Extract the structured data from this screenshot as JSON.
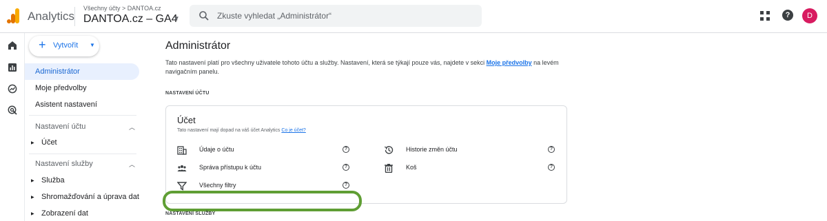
{
  "header": {
    "app_name": "Analytics",
    "breadcrumb": "Všechny účty > DANTOA.cz",
    "property": "DANTOA.cz – GA4",
    "search_placeholder": "Zkuste vyhledat „Administrátor“",
    "avatar_initial": "D",
    "help_glyph": "?",
    "icons": [
      "analytics-logo",
      "search-icon",
      "apps-icon",
      "help-icon"
    ],
    "accent_color": "#1a73e8"
  },
  "rail": {
    "icons": [
      "home-icon",
      "reports-icon",
      "explore-icon",
      "advertising-icon"
    ]
  },
  "nav": {
    "create_label": "Vytvořit",
    "items": [
      {
        "label": "Administrátor",
        "active": true
      },
      {
        "label": "Moje předvolby",
        "active": false
      },
      {
        "label": "Asistent nastavení",
        "active": false
      }
    ],
    "sections": [
      {
        "label": "Nastavení účtu",
        "children": [
          "Účet"
        ]
      },
      {
        "label": "Nastavení služby",
        "children": [
          "Služba",
          "Shromažďování a úprava dat",
          "Zobrazení dat"
        ]
      }
    ]
  },
  "main": {
    "title": "Administrátor",
    "description_before": "Tato nastavení platí pro všechny uživatele tohoto účtu a služby. Nastavení, která se týkají pouze vás, najdete v sekci ",
    "description_link": "Moje předvolby",
    "description_after": " na levém navigačním panelu.",
    "account_section_label": "NASTAVENÍ ÚČTU",
    "property_section_label": "NASTAVENÍ SLUŽBY",
    "card": {
      "title": "Účet",
      "subtitle": "Tato nastavení mají dopad na váš účet Analytics",
      "subtitle_link": "Co je účet?",
      "left_rows": [
        {
          "label": "Údaje o účtu",
          "icon": "building-icon"
        },
        {
          "label": "Správa přístupu k účtu",
          "icon": "people-icon"
        },
        {
          "label": "Všechny filtry",
          "icon": "filter-icon"
        }
      ],
      "right_rows": [
        {
          "label": "Historie změn účtu",
          "icon": "history-icon"
        },
        {
          "label": "Koš",
          "icon": "trash-icon"
        }
      ]
    },
    "highlight_color": "#5f9e34"
  }
}
